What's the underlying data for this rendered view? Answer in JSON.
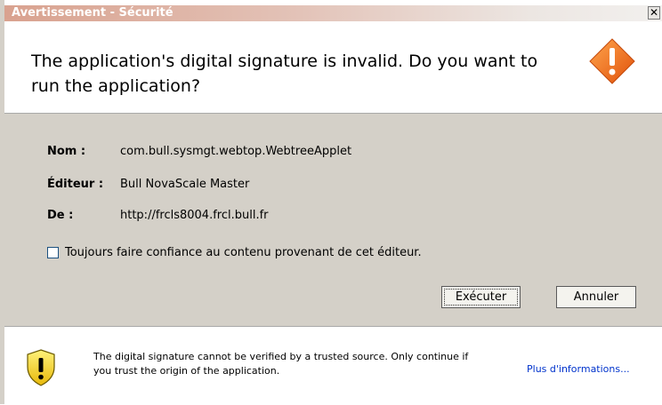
{
  "window": {
    "title": "Avertissement - Sécurité",
    "close_label": "✕"
  },
  "header": {
    "message": "The application's digital signature is invalid.  Do you want to run the application?",
    "icon": "warning-diamond-icon"
  },
  "details": {
    "name_label": "Nom :",
    "name_value": "com.bull.sysmgt.webtop.WebtreeApplet",
    "publisher_label": "Éditeur :",
    "publisher_value": "Bull NovaScale Master",
    "from_label": "De :",
    "from_value": "http://frcls8004.frcl.bull.fr"
  },
  "trust_checkbox": {
    "label": "Toujours faire confiance au contenu provenant de cet éditeur.",
    "checked": false
  },
  "buttons": {
    "run": "Exécuter",
    "cancel": "Annuler"
  },
  "footer": {
    "message": "The digital signature cannot be verified by a trusted source.  Only continue if you trust the origin of the application.",
    "more_info": "Plus d'informations...",
    "icon": "shield-warning-icon"
  },
  "colors": {
    "dialog_bg": "#d4d0c8",
    "warning_orange": "#f06a1a",
    "shield_yellow": "#f7d72a",
    "link_blue": "#0033cc"
  }
}
